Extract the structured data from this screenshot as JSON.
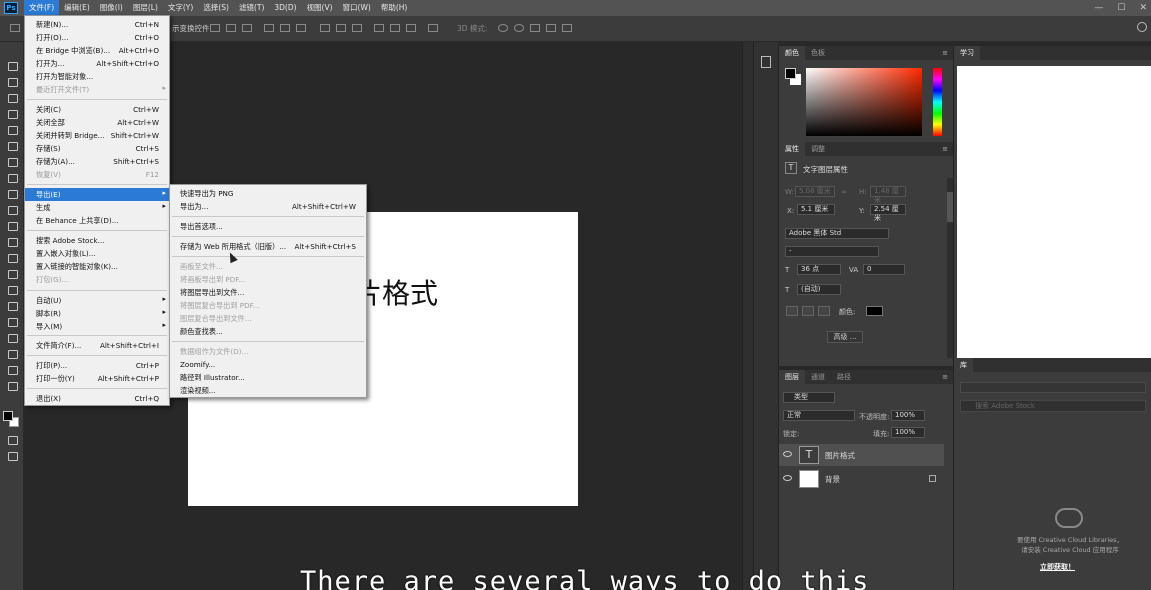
{
  "menubar": {
    "items": [
      "文件(F)",
      "编辑(E)",
      "图像(I)",
      "图层(L)",
      "文字(Y)",
      "选择(S)",
      "滤镜(T)",
      "3D(D)",
      "视图(V)",
      "窗口(W)",
      "帮助(H)"
    ]
  },
  "options": {
    "transform_text": "示变换控件",
    "mode_3d": "3D 模式:"
  },
  "file_menu": {
    "items": [
      {
        "label": "新建(N)...",
        "shortcut": "Ctrl+N"
      },
      {
        "label": "打开(O)...",
        "shortcut": "Ctrl+O"
      },
      {
        "label": "在 Bridge 中浏览(B)...",
        "shortcut": "Alt+Ctrl+O"
      },
      {
        "label": "打开为...",
        "shortcut": "Alt+Shift+Ctrl+O"
      },
      {
        "label": "打开为智能对象...",
        "shortcut": ""
      },
      {
        "label": "最近打开文件(T)",
        "shortcut": ""
      },
      {
        "label": "关闭(C)",
        "shortcut": "Ctrl+W"
      },
      {
        "label": "关闭全部",
        "shortcut": "Alt+Ctrl+W"
      },
      {
        "label": "关闭并转到 Bridge...",
        "shortcut": "Shift+Ctrl+W"
      },
      {
        "label": "存储(S)",
        "shortcut": "Ctrl+S"
      },
      {
        "label": "存储为(A)...",
        "shortcut": "Shift+Ctrl+S"
      },
      {
        "label": "恢复(V)",
        "shortcut": "F12"
      },
      {
        "label": "导出(E)",
        "shortcut": ""
      },
      {
        "label": "生成",
        "shortcut": ""
      },
      {
        "label": "在 Behance 上共享(D)...",
        "shortcut": ""
      },
      {
        "label": "搜索 Adobe Stock...",
        "shortcut": ""
      },
      {
        "label": "置入嵌入对象(L)...",
        "shortcut": ""
      },
      {
        "label": "置入链接的智能对象(K)...",
        "shortcut": ""
      },
      {
        "label": "打包(G)...",
        "shortcut": ""
      },
      {
        "label": "自动(U)",
        "shortcut": ""
      },
      {
        "label": "脚本(R)",
        "shortcut": ""
      },
      {
        "label": "导入(M)",
        "shortcut": ""
      },
      {
        "label": "文件简介(F)...",
        "shortcut": "Alt+Shift+Ctrl+I"
      },
      {
        "label": "打印(P)...",
        "shortcut": "Ctrl+P"
      },
      {
        "label": "打印一份(Y)",
        "shortcut": "Alt+Shift+Ctrl+P"
      },
      {
        "label": "退出(X)",
        "shortcut": "Ctrl+Q"
      }
    ]
  },
  "export_menu": {
    "items": [
      {
        "label": "快速导出为 PNG",
        "shortcut": ""
      },
      {
        "label": "导出为...",
        "shortcut": "Alt+Shift+Ctrl+W"
      },
      {
        "label": "导出首选项...",
        "shortcut": ""
      },
      {
        "label": "存储为 Web 所用格式（旧版）...",
        "shortcut": "Alt+Shift+Ctrl+S"
      },
      {
        "label": "画板至文件...",
        "shortcut": ""
      },
      {
        "label": "将画板导出到 PDF...",
        "shortcut": ""
      },
      {
        "label": "将图层导出到文件...",
        "shortcut": ""
      },
      {
        "label": "将图层复合导出到 PDF...",
        "shortcut": ""
      },
      {
        "label": "图层复合导出到文件...",
        "shortcut": ""
      },
      {
        "label": "颜色查找表...",
        "shortcut": ""
      },
      {
        "label": "数据组作为文件(D)...",
        "shortcut": ""
      },
      {
        "label": "Zoomify...",
        "shortcut": ""
      },
      {
        "label": "路径到 Illustrator...",
        "shortcut": ""
      },
      {
        "label": "渲染视频...",
        "shortcut": ""
      }
    ]
  },
  "canvas": {
    "text": "片格式"
  },
  "panels": {
    "color_tabs": [
      "颜色",
      "色板"
    ],
    "prop_tabs": [
      "属性",
      "调整"
    ],
    "prop_title": "文字图层属性",
    "w_label": "W:",
    "w_value": "5.08 厘米",
    "h_label": "H:",
    "h_value": "1.48 厘米",
    "x_label": "X:",
    "x_value": "5.1 厘米",
    "y_label": "Y:",
    "y_value": "2.54 厘米",
    "font": "Adobe 黑体 Std",
    "font_style": "-",
    "size": "36 点",
    "tracking": "0",
    "leading": "(自动)",
    "color_label": "颜色:",
    "advanced": "高级 ...",
    "layer_tabs": [
      "图层",
      "通道",
      "路径"
    ],
    "kind": "类型",
    "blend": "正常",
    "opacity_label": "不透明度:",
    "opacity": "100%",
    "lock_label": "锁定:",
    "fill_label": "填充:",
    "fill": "100%",
    "layers": [
      {
        "name": "图片格式",
        "type": "text"
      },
      {
        "name": "背景",
        "type": "bg"
      }
    ]
  },
  "right": {
    "learn_tab": "学习",
    "lib_tab": "库",
    "lib_search": "搜索 Adobe Stock",
    "cc_msg1": "要使用 Creative Cloud Libraries，",
    "cc_msg2": "请安装 Creative Cloud 应用程序",
    "cc_start": "立即获取！"
  },
  "subtitle": "There are several ways to do this"
}
